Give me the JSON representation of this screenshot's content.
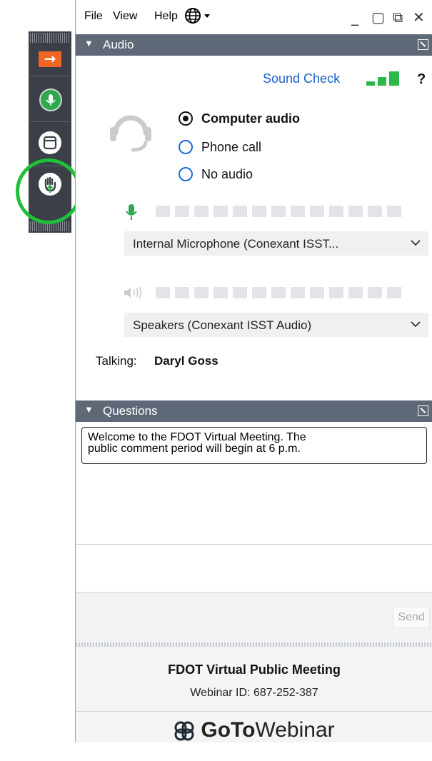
{
  "menu": {
    "file": "File",
    "view": "View",
    "help": "Help"
  },
  "window_controls": {
    "minimize": "_",
    "maximize": "▢",
    "popout": "⧉",
    "close": "✕"
  },
  "audio": {
    "section_title": "Audio",
    "sound_check": "Sound Check",
    "help": "?",
    "options": [
      {
        "label": "Computer audio",
        "selected": true
      },
      {
        "label": "Phone call",
        "selected": false
      },
      {
        "label": "No audio",
        "selected": false
      }
    ],
    "microphone": "Internal  Microphone  (Conexant  ISST...",
    "speakers": "Speakers (Conexant ISST Audio)",
    "talking_label": "Talking:",
    "talking_name": "Daryl Goss"
  },
  "questions": {
    "section_title": "Questions",
    "message_line1": "Welcome to the FDOT Virtual Meeting. The",
    "message_line2": "public comment period will begin at 6 p.m.",
    "send": "Send"
  },
  "footer": {
    "meeting_title": "FDOT Virtual Public Meeting",
    "webinar_id": "Webinar ID: 687-252-387",
    "brand_goto": "GoTo",
    "brand_webinar": "Webinar"
  },
  "colors": {
    "accent_orange": "#f26522",
    "green": "#2ea84f",
    "highlight_ring": "#1fbf3a",
    "section_bar": "#5f6877",
    "link_blue": "#1a5fc8"
  },
  "icons": [
    "grab-tab-icon",
    "arrow-right-icon",
    "microphone-icon",
    "panel-icon",
    "raise-hand-icon",
    "globe-icon",
    "headset-icon",
    "speaker-icon",
    "chevron-down-icon",
    "popout-icon"
  ]
}
